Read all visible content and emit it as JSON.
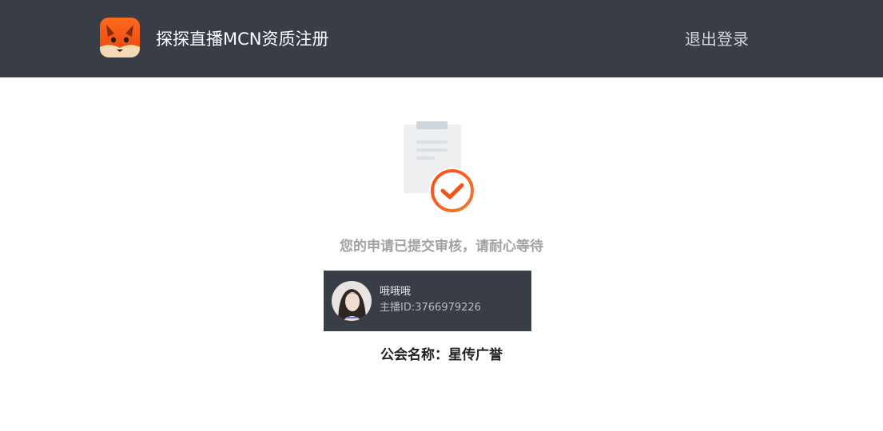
{
  "header": {
    "title": "探探直播MCN资质注册",
    "logout_label": "退出登录",
    "logo_icon": "fox-logo-icon",
    "background_color": "#393d45"
  },
  "status": {
    "illustration_icon": "clipboard-check-icon",
    "message": "您的申请已提交审核，请耐心等待",
    "accent_color": "#f0541a"
  },
  "anchor": {
    "name": "哦哦哦",
    "id_label": "主播ID:",
    "id_value": "3766979226",
    "avatar_icon": "avatar-photo"
  },
  "guild": {
    "label": "公会名称：",
    "name": "星传广誉"
  }
}
